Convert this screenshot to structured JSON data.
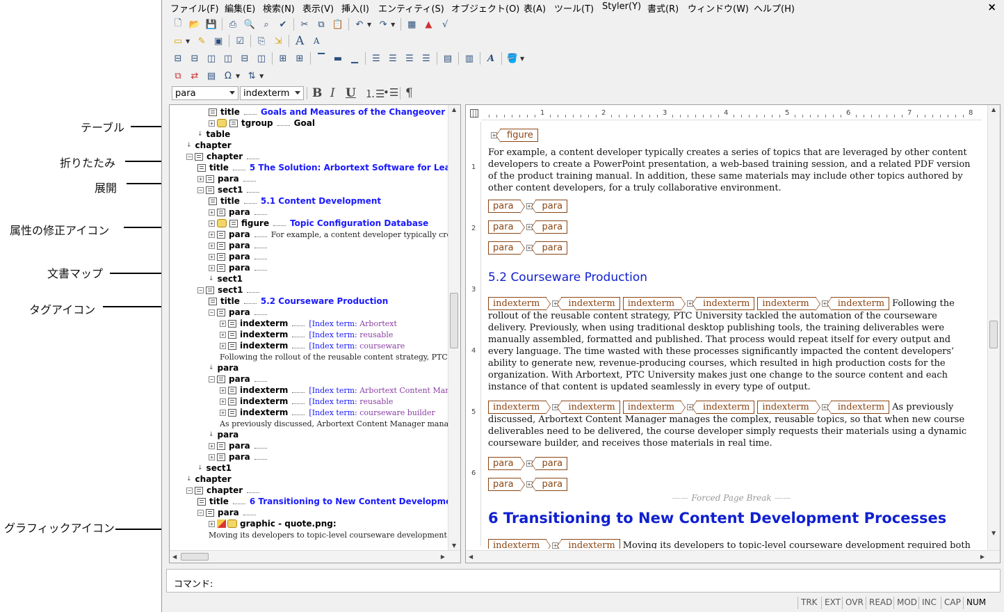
{
  "annotations": [
    {
      "label": "テーブル"
    },
    {
      "label": "折りたたみ"
    },
    {
      "label": "展開"
    },
    {
      "label": "属性の修正アイコン"
    },
    {
      "label": "文書マップ"
    },
    {
      "label": "タグアイコン"
    },
    {
      "label": "グラフィックアイコン"
    }
  ],
  "menu": [
    "ファイル(F)",
    "編集(E)",
    "検索(N)",
    "表示(V)",
    "挿入(I)",
    "エンティティ(S)",
    "オブジェクト(O)",
    "表(A)",
    "ツール(T)",
    "Styler(Y)",
    "書式(R)",
    "ウィンドウ(W)",
    "ヘルプ(H)"
  ],
  "window_close": "×",
  "toolbar": {
    "element_combo": "para",
    "index_combo": "indexterm",
    "bold": "B",
    "italic": "I",
    "underline": "U",
    "pilcrow": "¶",
    "font_grow": "A",
    "font_shrink": "A",
    "omega": "Ω"
  },
  "tree": [
    {
      "tag": "title",
      "text": "Goals and Measures of the Changeover",
      "kind": "title"
    },
    {
      "tag": "tgroup",
      "text": "Goal",
      "kind": "plain"
    },
    {
      "tag": "table",
      "text": "",
      "kind": "end"
    },
    {
      "tag": "chapter",
      "text": "",
      "kind": "end"
    },
    {
      "tag": "chapter",
      "text": "",
      "kind": "node"
    },
    {
      "tag": "title",
      "text": "5 The Solution: Arbortext Software for Lea",
      "kind": "title"
    },
    {
      "tag": "para",
      "text": "",
      "kind": "node"
    },
    {
      "tag": "sect1",
      "text": "",
      "kind": "node"
    },
    {
      "tag": "title",
      "text": "5.1 Content Development",
      "kind": "title"
    },
    {
      "tag": "para",
      "text": "",
      "kind": "node"
    },
    {
      "tag": "figure",
      "text": "Topic Configuration Database",
      "kind": "title"
    },
    {
      "tag": "para",
      "text": "For example, a content developer typically creat",
      "kind": "text"
    },
    {
      "tag": "para",
      "text": "",
      "kind": "node"
    },
    {
      "tag": "para",
      "text": "",
      "kind": "node"
    },
    {
      "tag": "para",
      "text": "",
      "kind": "node"
    },
    {
      "tag": "sect1",
      "text": "",
      "kind": "end"
    },
    {
      "tag": "sect1",
      "text": "",
      "kind": "node"
    },
    {
      "tag": "title",
      "text": "5.2 Courseware Production",
      "kind": "title"
    },
    {
      "tag": "para",
      "text": "",
      "kind": "node"
    },
    {
      "tag": "indexterm",
      "prefix": "[Index term: ",
      "text": "Arbortext",
      "kind": "index"
    },
    {
      "tag": "indexterm",
      "prefix": "[Index term: ",
      "text": "reusable",
      "kind": "index"
    },
    {
      "tag": "indexterm",
      "prefix": "[Index term: ",
      "text": "courseware",
      "kind": "index"
    },
    {
      "tag": "",
      "text": "Following the rollout of the reusable content strategy, PTC",
      "kind": "textonly"
    },
    {
      "tag": "para",
      "text": "",
      "kind": "end"
    },
    {
      "tag": "para",
      "text": "",
      "kind": "node"
    },
    {
      "tag": "indexterm",
      "prefix": "[Index term: ",
      "text": "Arbortext Content Manag",
      "kind": "index"
    },
    {
      "tag": "indexterm",
      "prefix": "[Index term: ",
      "text": "reusable",
      "kind": "index"
    },
    {
      "tag": "indexterm",
      "prefix": "[Index term: ",
      "text": "courseware builder",
      "kind": "index"
    },
    {
      "tag": "",
      "text": "As previously discussed, Arbortext Content Manager mana",
      "kind": "textonly"
    },
    {
      "tag": "para",
      "text": "",
      "kind": "end"
    },
    {
      "tag": "para",
      "text": "",
      "kind": "node"
    },
    {
      "tag": "para",
      "text": "",
      "kind": "node"
    },
    {
      "tag": "sect1",
      "text": "",
      "kind": "end"
    },
    {
      "tag": "chapter",
      "text": "",
      "kind": "end"
    },
    {
      "tag": "chapter",
      "text": "",
      "kind": "node"
    },
    {
      "tag": "title",
      "text": "6 Transitioning to New Content Developme",
      "kind": "title"
    },
    {
      "tag": "para",
      "text": "",
      "kind": "node"
    },
    {
      "tag": "graphic - quote.png:",
      "text": "",
      "kind": "graphic"
    },
    {
      "tag": "",
      "text": "Moving its developers to topic-level courseware development",
      "kind": "textonly"
    }
  ],
  "document": {
    "figure_tag": "figure",
    "para1": "For example, a content developer typically creates a series of topics that are leveraged by other content developers to create a PowerPoint presentation, a web-based training session, and a related PDF version of the product training manual. In addition, these same materials may include other topics authored by other content developers, for a truly collaborative environment.",
    "para_tag": "para",
    "heading52": "5.2 Courseware Production",
    "indexterm_tag": "indexterm",
    "para2_first": "Following",
    "para2_rest": "the rollout of the reusable content strategy, PTC University tackled the automation of the courseware delivery. Previously, when using traditional desktop publishing tools, the training deliverables were manually assembled, formatted and published. That process would repeat itself for every output and every language. The time wasted with these processes significantly impacted the content developers’ ability to generate new, revenue-producing courses, which resulted in high production costs for the organization. With Arbortext, PTC University makes just one change to the source content and each instance of that content is updated seamlessly in every type of output.",
    "para3_first": "As",
    "para3_rest": "previously discussed, Arbortext Content Manager manages the complex, reusable topics, so that when new course deliverables need to be delivered, the course developer simply requests their materials using a dynamic courseware builder, and receives those materials in real time.",
    "page_break": "Forced Page Break",
    "heading6": "6 Transitioning to New Content Development Processes",
    "para4_rest": "Moving its developers to topic-level courseware development required both"
  },
  "ruler": [
    "1",
    "2",
    "3",
    "4",
    "5",
    "6",
    "7",
    "8"
  ],
  "ruler_left": [
    "1",
    "2",
    "3",
    "4",
    "5",
    "6"
  ],
  "command_label": "コマンド:",
  "status": [
    "TRK",
    "EXT",
    "OVR",
    "READ",
    "MOD",
    "INC",
    "CAP",
    "NUM"
  ]
}
